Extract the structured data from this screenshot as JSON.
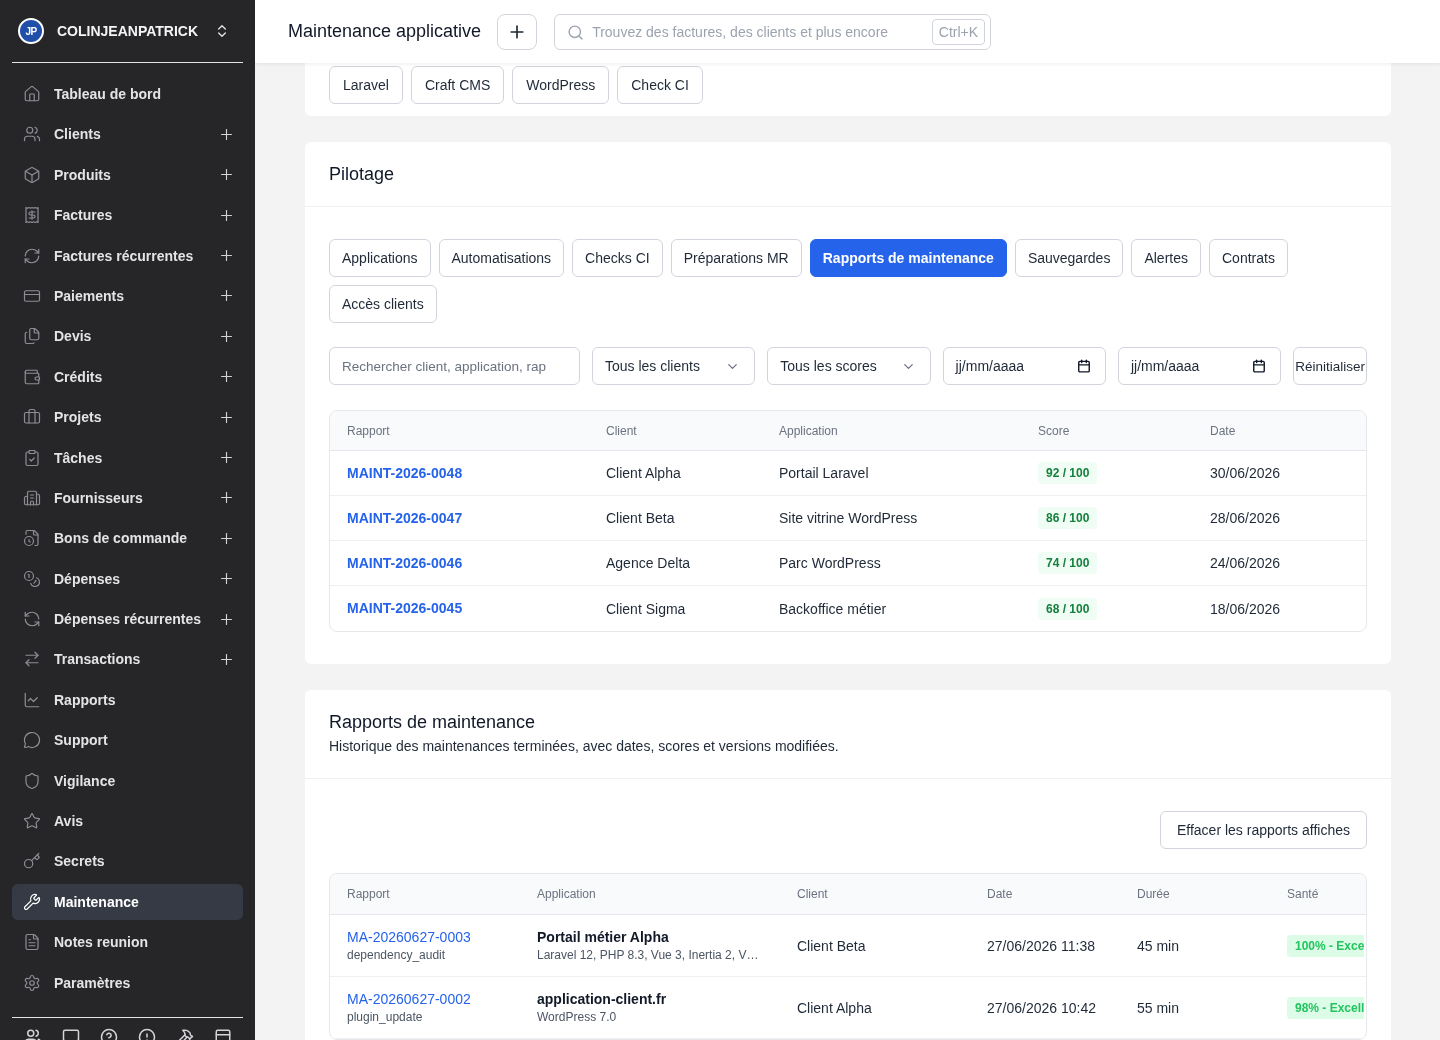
{
  "sidebar": {
    "brand": {
      "logo_text": "JP",
      "name": "COLINJEANPATRICK"
    },
    "items": [
      {
        "label": "Tableau de bord",
        "addable": false,
        "selected": false
      },
      {
        "label": "Clients",
        "addable": true,
        "selected": false
      },
      {
        "label": "Produits",
        "addable": true,
        "selected": false
      },
      {
        "label": "Factures",
        "addable": true,
        "selected": false
      },
      {
        "label": "Factures récurrentes",
        "addable": true,
        "selected": false
      },
      {
        "label": "Paiements",
        "addable": true,
        "selected": false
      },
      {
        "label": "Devis",
        "addable": true,
        "selected": false
      },
      {
        "label": "Crédits",
        "addable": true,
        "selected": false
      },
      {
        "label": "Projets",
        "addable": true,
        "selected": false
      },
      {
        "label": "Tâches",
        "addable": true,
        "selected": false
      },
      {
        "label": "Fournisseurs",
        "addable": true,
        "selected": false
      },
      {
        "label": "Bons de commande",
        "addable": true,
        "selected": false
      },
      {
        "label": "Dépenses",
        "addable": true,
        "selected": false
      },
      {
        "label": "Dépenses récurrentes",
        "addable": true,
        "selected": false
      },
      {
        "label": "Transactions",
        "addable": true,
        "selected": false
      },
      {
        "label": "Rapports",
        "addable": false,
        "selected": false
      },
      {
        "label": "Support",
        "addable": false,
        "selected": false
      },
      {
        "label": "Vigilance",
        "addable": false,
        "selected": false
      },
      {
        "label": "Avis",
        "addable": false,
        "selected": false
      },
      {
        "label": "Secrets",
        "addable": false,
        "selected": false
      },
      {
        "label": "Maintenance",
        "addable": false,
        "selected": true
      },
      {
        "label": "Notes reunion",
        "addable": false,
        "selected": false
      },
      {
        "label": "Paramètres",
        "addable": false,
        "selected": false
      }
    ]
  },
  "topbar": {
    "title": "Maintenance applicative",
    "search": {
      "placeholder": "Trouvez des factures, des clients et plus encore",
      "shortcut": "Ctrl+K"
    }
  },
  "tech_card": {
    "tags": [
      "Laravel",
      "Craft CMS",
      "WordPress",
      "Check CI"
    ]
  },
  "pilotage": {
    "title": "Pilotage",
    "tabs": [
      {
        "label": "Applications",
        "selected": false
      },
      {
        "label": "Automatisations",
        "selected": false
      },
      {
        "label": "Checks CI",
        "selected": false
      },
      {
        "label": "Préparations MR",
        "selected": false
      },
      {
        "label": "Rapports de maintenance",
        "selected": true
      },
      {
        "label": "Sauvegardes",
        "selected": false
      },
      {
        "label": "Alertes",
        "selected": false
      },
      {
        "label": "Contrats",
        "selected": false
      },
      {
        "label": "Accès clients",
        "selected": false
      }
    ],
    "filters": {
      "search": {
        "placeholder": "Rechercher client, application, rap"
      },
      "selects": [
        {
          "value": "Tous les clients"
        },
        {
          "value": "Tous les scores"
        }
      ],
      "dates": [
        {
          "placeholder": "jj/mm/aaaa"
        },
        {
          "placeholder": "jj/mm/aaaa"
        }
      ],
      "reset": "Réinitialiser"
    },
    "table": {
      "columns": [
        "Rapport",
        "Client",
        "Application",
        "Score",
        "Date"
      ],
      "rows": [
        {
          "report": "MAINT-2026-0048",
          "client": "Client Alpha",
          "application": "Portail Laravel",
          "score": "92 / 100",
          "date": "30/06/2026"
        },
        {
          "report": "MAINT-2026-0047",
          "client": "Client Beta",
          "application": "Site vitrine WordPress",
          "score": "86 / 100",
          "date": "28/06/2026"
        },
        {
          "report": "MAINT-2026-0046",
          "client": "Agence Delta",
          "application": "Parc WordPress",
          "score": "74 / 100",
          "date": "24/06/2026"
        },
        {
          "report": "MAINT-2026-0045",
          "client": "Client Sigma",
          "application": "Backoffice métier",
          "score": "68 / 100",
          "date": "18/06/2026"
        }
      ]
    }
  },
  "reports": {
    "title": "Rapports de maintenance",
    "description": "Historique des maintenances terminées, avec dates, scores et versions modifiées.",
    "clear_button": "Effacer les rapports affiches",
    "table": {
      "columns": [
        "Rapport",
        "Application",
        "Client",
        "Date",
        "Durée",
        "Santé"
      ],
      "rows": [
        {
          "report": "MA-20260627-0003",
          "type": "dependency_audit",
          "application": "Portail métier Alpha",
          "stack": "Laravel 12, PHP 8.3, Vue 3, Inertia 2, V…",
          "client": "Client Beta",
          "date": "27/06/2026 11:38",
          "duration": "45 min",
          "health": "100% - Exce"
        },
        {
          "report": "MA-20260627-0002",
          "type": "plugin_update",
          "application": "application-client.fr",
          "stack": "WordPress 7.0",
          "client": "Client Alpha",
          "date": "27/06/2026 10:42",
          "duration": "55 min",
          "health": "98% - Excell"
        }
      ]
    }
  }
}
